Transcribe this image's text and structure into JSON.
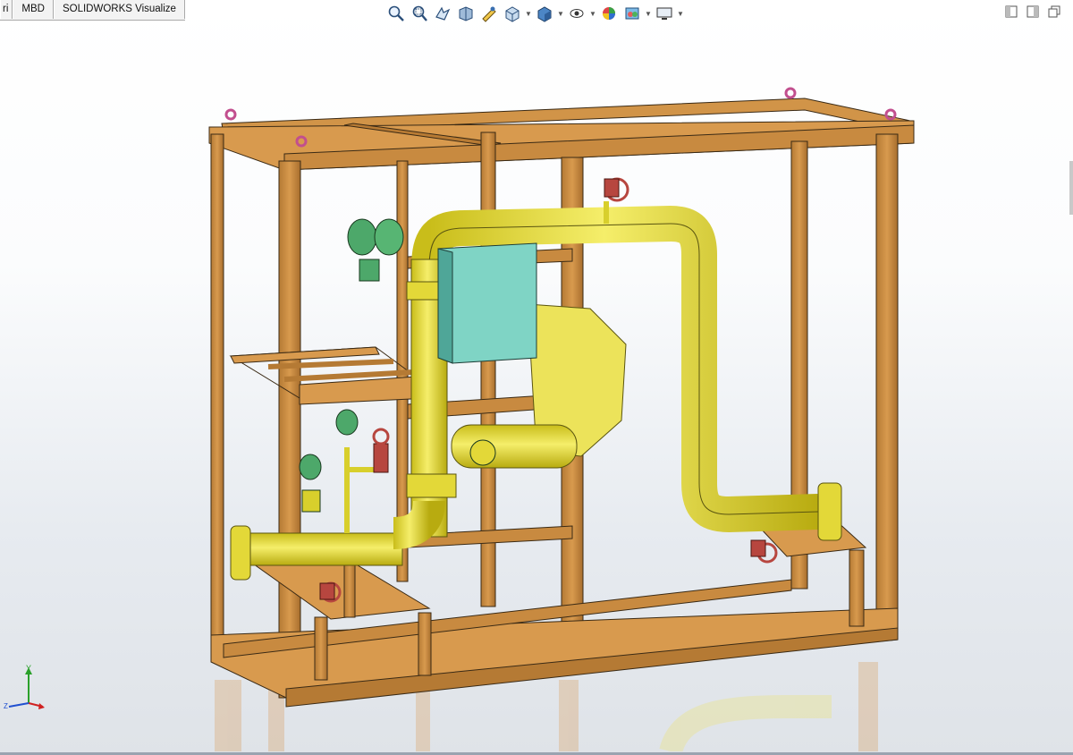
{
  "tabs": [
    {
      "label": "ri"
    },
    {
      "label": "MBD"
    },
    {
      "label": "SOLIDWORKS Visualize"
    }
  ],
  "heads_up_toolbar": [
    {
      "icon": "zoom-to-fit-icon"
    },
    {
      "icon": "zoom-to-area-icon"
    },
    {
      "icon": "previous-view-icon"
    },
    {
      "icon": "section-view-icon"
    },
    {
      "icon": "dynamic-annotation-views-icon"
    },
    {
      "icon": "view-orientation-icon"
    },
    {
      "icon": "display-style-icon"
    },
    {
      "icon": "hide-show-items-icon"
    },
    {
      "icon": "edit-appearance-icon"
    },
    {
      "icon": "apply-scene-icon"
    },
    {
      "icon": "view-settings-icon"
    }
  ],
  "window_controls": [
    {
      "icon": "tile-left-icon"
    },
    {
      "icon": "tile-right-icon"
    },
    {
      "icon": "restore-window-icon"
    }
  ],
  "triad_axes": {
    "y": "Y",
    "x": "X",
    "z": "Z"
  },
  "colors": {
    "frame": "#c98b3f",
    "pipe": "#e9df2b",
    "panel": "#7fd4c5",
    "valve": "#b7463f",
    "transmitter": "#4da86a",
    "lifting_eye": "#c24f8e"
  }
}
